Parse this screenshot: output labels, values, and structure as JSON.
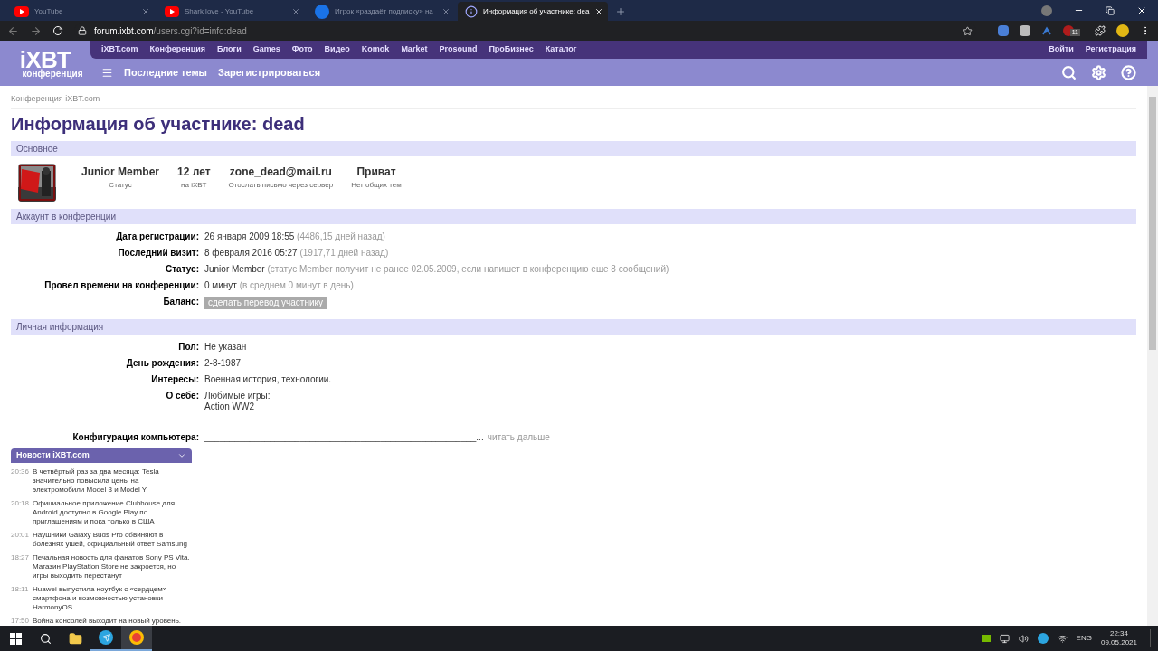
{
  "browser": {
    "tabs": [
      {
        "title": "YouTube",
        "kind": "youtube",
        "selected": false
      },
      {
        "title": "Shark love - YouTube",
        "kind": "youtube",
        "selected": false
      },
      {
        "title": "Игрок «раздаёт подписку» на",
        "kind": "g",
        "selected": false
      },
      {
        "title": "Информация об участнике: dea",
        "kind": "info",
        "selected": true
      }
    ],
    "url_host": "forum.ixbt.com",
    "url_path": "/users.cgi?id=info:dead",
    "extension_badge": "11"
  },
  "site": {
    "logo_main": "iXBT",
    "logo_sub": "конференция",
    "top_links": [
      "iXBT.com",
      "Конференция",
      "Блоги",
      "Games",
      "Фото",
      "Видео",
      "Komok",
      "Market",
      "Prosound",
      "ПроБизнес",
      "Каталог"
    ],
    "account_links": [
      "Войти",
      "Регистрация"
    ],
    "nav_links": [
      "Последние темы",
      "Зарегистрироваться"
    ]
  },
  "breadcrumb": "Конференция iXBT.com",
  "title": "Информация об участнике: dead",
  "summary": {
    "heading": "Основное",
    "stats": [
      {
        "value": "Junior Member",
        "caption": "Статус"
      },
      {
        "value": "12 лет",
        "caption": "на iXBT"
      },
      {
        "value": "zone_dead@mail.ru",
        "caption": "Отослать письмо через сервер"
      },
      {
        "value": "Приват",
        "caption": "Нет общих тем"
      }
    ]
  },
  "sections": [
    {
      "heading": "Аккаунт в конференции",
      "rows": [
        {
          "kind": "text",
          "label": "Дата регистрации:",
          "value": "26 января 2009 18:55",
          "note": "(4486,15 дней назад)"
        },
        {
          "kind": "text",
          "label": "Последний визит:",
          "value": "8 февраля 2016 05:27",
          "note": "(1917,71 дней назад)"
        },
        {
          "kind": "text",
          "label": "Статус:",
          "value": "Junior Member",
          "note": "(статус Member получит не ранее 02.05.2009, если напишет в конференцию еще 8 сообщений)"
        },
        {
          "kind": "text",
          "label": "Провел времени на конференции:",
          "value": "0 минут",
          "note": "(в среднем 0 минут в день)"
        },
        {
          "kind": "button",
          "label": "Баланс:",
          "value": "сделать перевод участнику"
        }
      ]
    },
    {
      "heading": "Личная информация",
      "rows": [
        {
          "kind": "text",
          "label": "Пол:",
          "value": "Не указан"
        },
        {
          "kind": "text",
          "label": "День рождения:",
          "value": "2-8-1987"
        },
        {
          "kind": "text",
          "label": "Интересы:",
          "value": "Военная история, технологии."
        },
        {
          "kind": "lines",
          "label": "О себе:",
          "lines": [
            "Любимые игры:",
            "Action WW2"
          ]
        },
        {
          "kind": "more",
          "label": "Конфигурация компьютера:",
          "value": "______________________________________________________...",
          "note": "читать дальше"
        }
      ]
    }
  ],
  "news": {
    "title": "Новости iXBT.com",
    "items": [
      {
        "time": "20:36",
        "text": "В четвёртый раз за два месяца: Tesla значительно повысила цены на электромобили Model 3 и Model Y"
      },
      {
        "time": "20:18",
        "text": "Официальное приложение Clubhouse для Android доступно в Google Play по приглашениям и пока только в США"
      },
      {
        "time": "20:01",
        "text": "Наушники Galaxy Buds Pro обвиняют в болезнях ушей, официальный ответ Samsung"
      },
      {
        "time": "18:27",
        "text": "Печальная новость для фанатов Sony PS Vita. Магазин PlayStation Store не закроется, но игры выходить перестанут"
      },
      {
        "time": "18:11",
        "text": "Huawei выпустила ноутбук с «сердцем» смартфона и возможностью установки HarmonyOS"
      },
      {
        "time": "17:50",
        "text": "Война консолей выходит на новый уровень."
      }
    ]
  },
  "taskbar": {
    "language": "ENG",
    "time": "22:34",
    "date": "09.05.2021"
  }
}
